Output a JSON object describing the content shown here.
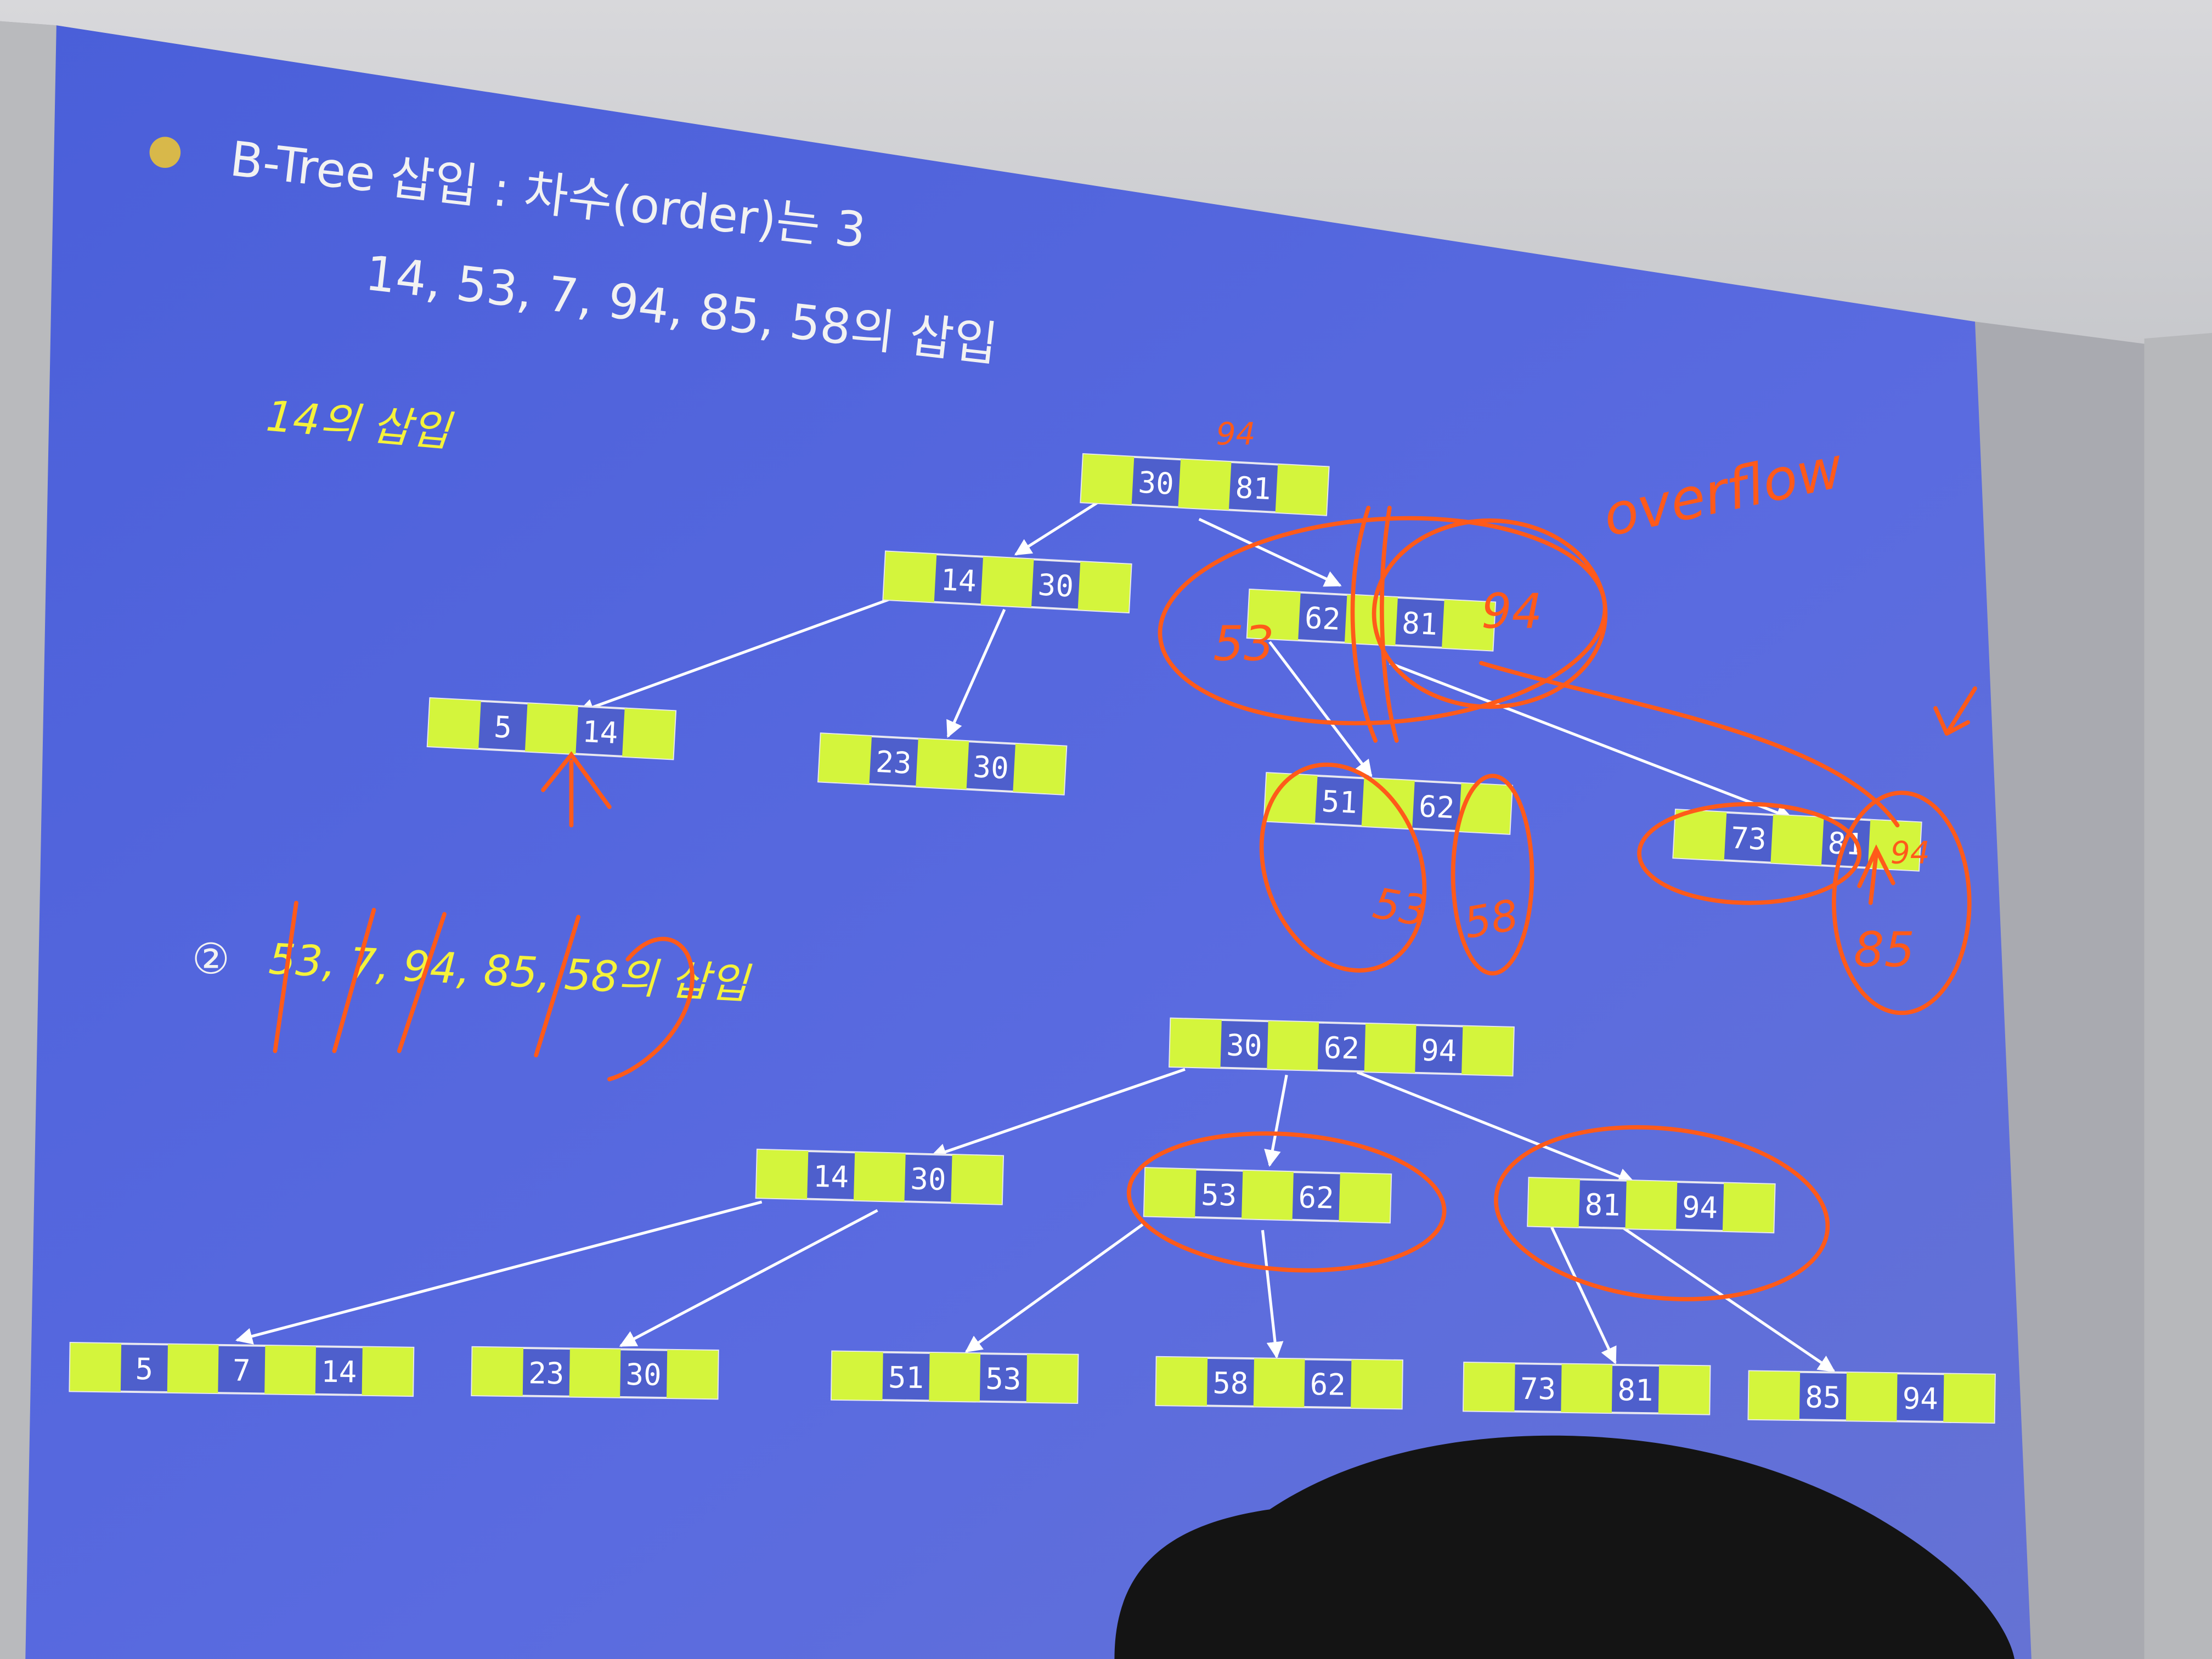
{
  "slide": {
    "title": "B-Tree 삽입 : 차수(order)는 3",
    "subtitle": "14, 53, 7, 94, 85, 58의 삽입",
    "step1_label": "14의 삽입",
    "step2_label": "53, 7, 94, 85, 58의 삽입",
    "step2_marker": "②"
  },
  "colors": {
    "slide_bg": "#4f63d6",
    "key_cell": "#d4f53c",
    "ink": "#ff5a1a",
    "text_yellow": "#f5f23a",
    "text_white": "#f2f2f2"
  },
  "tree1": {
    "nodes": [
      {
        "id": "t1-root",
        "keys": [
          "30",
          "81"
        ]
      },
      {
        "id": "t1-left",
        "keys": [
          "14",
          "30"
        ]
      },
      {
        "id": "t1-right",
        "keys": [
          "62",
          "81"
        ]
      },
      {
        "id": "t1-leaf1",
        "keys": [
          "5",
          "14"
        ]
      },
      {
        "id": "t1-leaf2",
        "keys": [
          "23",
          "30"
        ]
      },
      {
        "id": "t1-leaf3",
        "keys": [
          "51",
          "62"
        ]
      },
      {
        "id": "t1-leaf4",
        "keys": [
          "73",
          "81"
        ]
      }
    ]
  },
  "tree2": {
    "nodes": [
      {
        "id": "t2-root",
        "keys": [
          "30",
          "62",
          "94"
        ]
      },
      {
        "id": "t2-mid1",
        "keys": [
          "14",
          "30"
        ]
      },
      {
        "id": "t2-mid2",
        "keys": [
          "53",
          "62"
        ]
      },
      {
        "id": "t2-mid3",
        "keys": [
          "81",
          "94"
        ]
      },
      {
        "id": "t2-leaf1",
        "keys": [
          "5",
          "7",
          "14"
        ]
      },
      {
        "id": "t2-leaf2",
        "keys": [
          "23",
          "30"
        ]
      },
      {
        "id": "t2-leaf3",
        "keys": [
          "51",
          "53"
        ]
      },
      {
        "id": "t2-leaf4",
        "keys": [
          "58",
          "62"
        ]
      },
      {
        "id": "t2-leaf5",
        "keys": [
          "73",
          "81"
        ]
      },
      {
        "id": "t2-leaf6",
        "keys": [
          "85",
          "94"
        ]
      }
    ]
  },
  "annotations": {
    "overflow": "overflow",
    "root_94": "94",
    "node_53": "53",
    "node_94": "94",
    "leaf_53": "53",
    "leaf_58": "58",
    "leaf_94": "94",
    "leaf_85": "85"
  }
}
